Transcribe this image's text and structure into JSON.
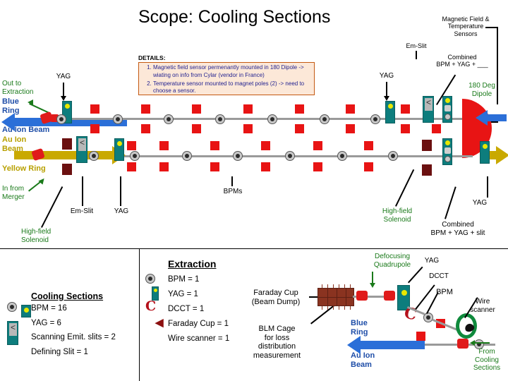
{
  "title": "Scope: Cooling Sections",
  "details": {
    "label": "DETAILS:",
    "items": [
      "Magnetic field sensor permenantly mounted in 180 Dipole -> wiating on info from Cylar (vendor in France)",
      "Temperature sensor mounted to magnet poles (2) -> need to choose a sensor."
    ]
  },
  "annotations": {
    "magnetic_field_temp_sensors": "Magnetic Field &\nTemperature\nSensors",
    "em_slit_top": "Em-Slit",
    "combined_bpm_yag_blank": "Combined\nBPM + YAG + ___",
    "dipole_180": "180 Deg\nDipole",
    "yag_top_left": "YAG",
    "yag_right_upper": "YAG",
    "out_to_extraction": "Out to\nExtraction",
    "blue_ring_left": "Blue\nRing",
    "au_ion_beam_blue_left": "Au Ion Beam",
    "au_ion_beam_yellow": "Au Ion\nBeam",
    "yellow_ring": "Yellow Ring",
    "in_from_merger": "In from\nMerger",
    "high_field_solenoid_left": "High-field\nSolenoid",
    "em_slit_lower_left": "Em-Slit",
    "yag_lower_left": "YAG",
    "bpms": "BPMs",
    "high_field_solenoid_right": "High-field\nSolenoid",
    "combined_bpm_yag_slit": "Combined\nBPM + YAG + slit",
    "yag_lower_right": "YAG",
    "defocusing_quadrupole": "Defocusing\nQuadrupole",
    "yag_bottom_right": "YAG",
    "dcct_bottom_right": "DCCT",
    "bpm_bottom_right": "BPM",
    "wire_scanner": "Wire\nscanner",
    "faraday_cup_beam_dump": "Faraday Cup\n(Beam Dump)",
    "blm_cage": "BLM Cage\nfor loss\ndistribution\nmeasurement",
    "blue_ring_bottom": "Blue\nRing",
    "au_ion_beam_bottom": "Au Ion\nBeam",
    "from_cooling_sections": "From\nCooling\nSections"
  },
  "legends": {
    "cooling_sections": {
      "title": "Cooling Sections",
      "items": [
        "BPM = 16",
        "YAG = 6",
        "Scanning Emit. slits = 2",
        "Defining Slit = 1"
      ]
    },
    "extraction": {
      "title": "Extraction",
      "items": [
        "BPM = 1",
        "YAG = 1",
        "DCCT = 1",
        "Faraday Cup = 1",
        "Wire scanner = 1"
      ]
    }
  },
  "colors": {
    "quadrupole_red": "#e81414",
    "yag_teal": "#0d7d7d",
    "blue_beam": "#2b6fd8",
    "yellow_beam": "#c9a900",
    "green_text": "#1a7a1a",
    "details_box_bg": "#fce8d8",
    "details_box_border": "#c45911",
    "details_text": "#1f1f8f"
  }
}
